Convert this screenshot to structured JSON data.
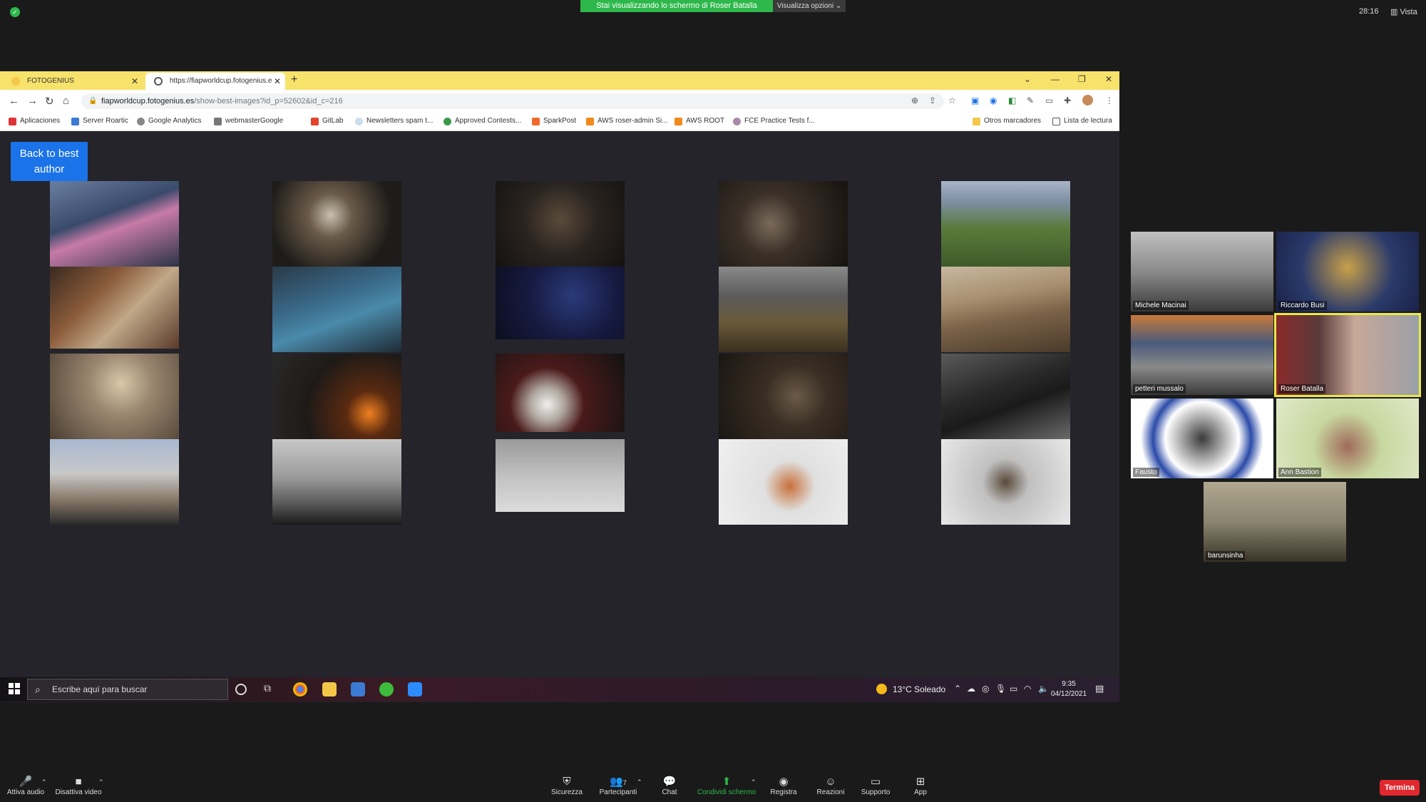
{
  "zoom": {
    "share_banner": "Stai visualizzando lo schermo di Roser Batalla",
    "view_options": "Visualizza opzioni ⌄",
    "timer": "28:16",
    "view_label": "Vista",
    "end_label": "Termina",
    "toolbar": [
      {
        "label": "Attiva audio",
        "icon": "microphone-muted-icon"
      },
      {
        "label": "Disattiva video",
        "icon": "video-camera-icon"
      },
      {
        "label": "Sicurezza",
        "icon": "shield-icon"
      },
      {
        "label": "Partecipanti",
        "icon": "participants-icon",
        "count": "7"
      },
      {
        "label": "Chat",
        "icon": "chat-icon"
      },
      {
        "label": "Condividi schermo",
        "icon": "share-screen-icon"
      },
      {
        "label": "Registra",
        "icon": "record-icon"
      },
      {
        "label": "Reazioni",
        "icon": "reactions-icon"
      },
      {
        "label": "Supporto",
        "icon": "support-icon"
      },
      {
        "label": "App",
        "icon": "apps-icon"
      }
    ],
    "participants": [
      {
        "name": "Michele Macinai"
      },
      {
        "name": "Riccardo Busi"
      },
      {
        "name": "petteri mussalo"
      },
      {
        "name": "Roser Batalla"
      },
      {
        "name": "Fausto"
      },
      {
        "name": "Ann Bastion"
      },
      {
        "name": "barunsinha"
      }
    ]
  },
  "browser": {
    "tabs": [
      {
        "title": "FOTOGENIUS"
      },
      {
        "title": "https://fiapworldcup.fotogenius.e"
      }
    ],
    "url_host": "fiapworldcup.fotogenius.es",
    "url_path": "/show-best-images?id_p=52602&id_c=216",
    "bookmarks": [
      "Aplicaciones",
      "Server Roartic",
      "Google Analytics",
      "webmasterGoogle",
      "GitLab",
      "Newsletters spam t...",
      "Approved Contests...",
      "SparkPost",
      "AWS roser-admin Si...",
      "AWS ROOT",
      "FCE Practice Tests f...",
      "Otros marcadores",
      "Lista de lectura"
    ]
  },
  "page": {
    "back_button": "Back to best author"
  },
  "taskbar": {
    "search_placeholder": "Escribe aquí para buscar",
    "weather": "13°C  Soleado",
    "time": "9:35",
    "date": "04/12/2021"
  }
}
